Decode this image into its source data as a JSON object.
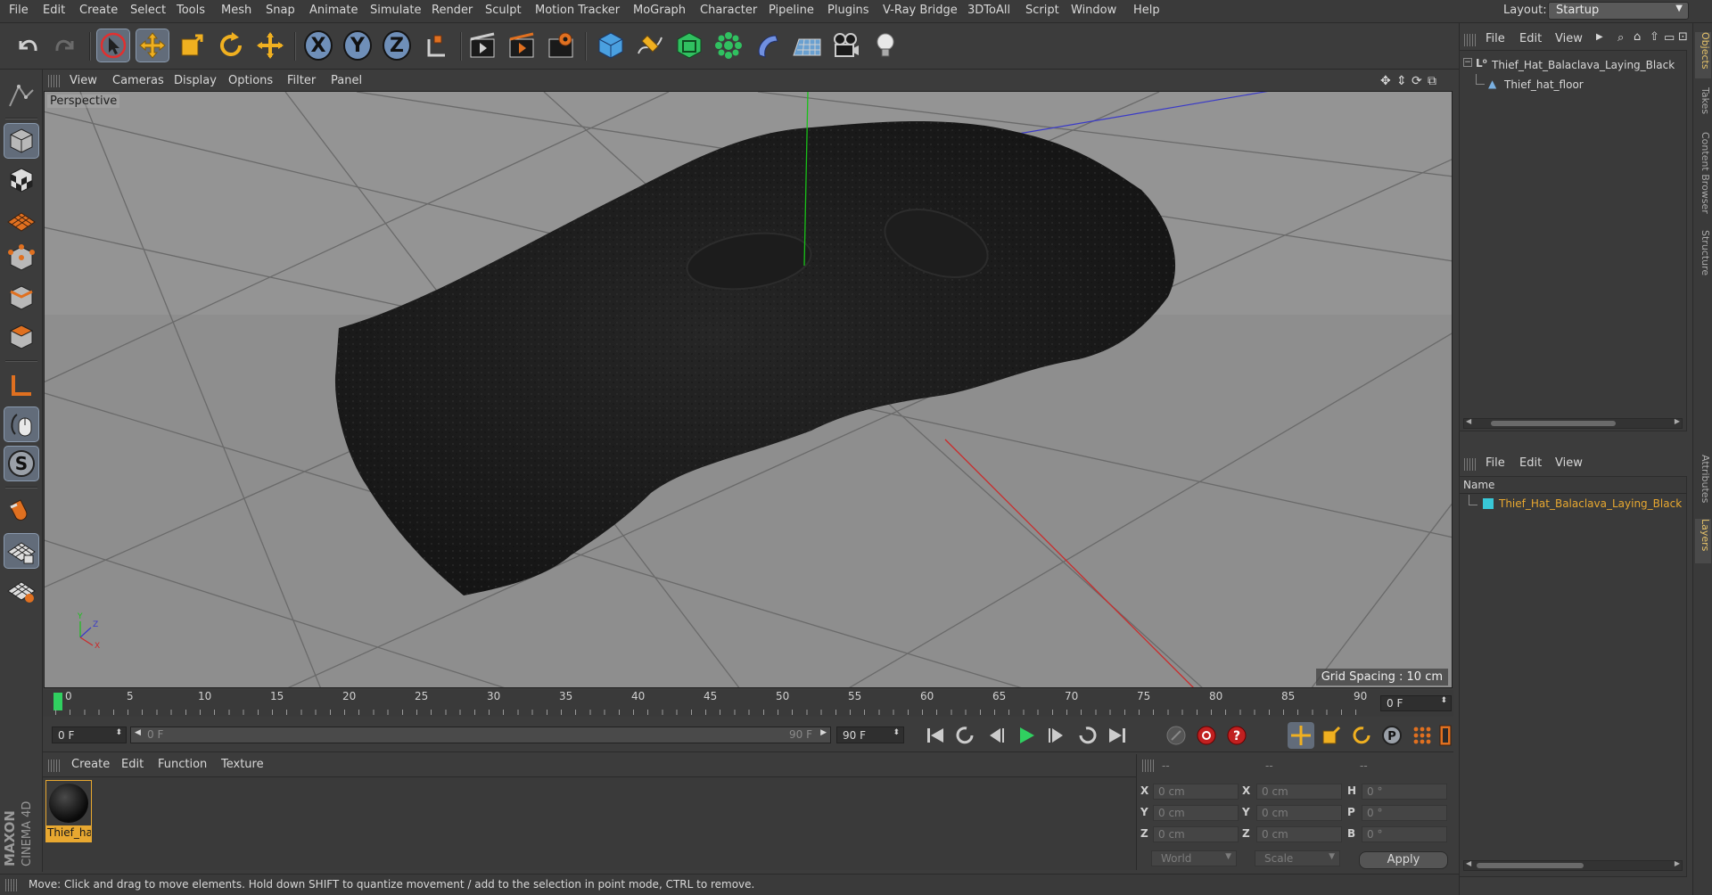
{
  "menubar": {
    "items": [
      "File",
      "Edit",
      "Create",
      "Select",
      "Tools",
      "Mesh",
      "Snap",
      "Animate",
      "Simulate",
      "Render",
      "Sculpt",
      "Motion Tracker",
      "MoGraph",
      "Character",
      "Pipeline",
      "Plugins",
      "V-Ray Bridge",
      "3DToAll",
      "Script",
      "Window",
      "Help"
    ],
    "layout_label": "Layout:",
    "layout_value": "Startup"
  },
  "viewport": {
    "menu": [
      "View",
      "Cameras",
      "Display",
      "Options",
      "Filter",
      "Panel"
    ],
    "camera_label": "Perspective",
    "grid_spacing": "Grid Spacing : 10 cm",
    "colors": {
      "background": "#8f8f8f",
      "object": "#1c1c1c",
      "y_axis": "#19c219",
      "x_axis": "#cc2a2a",
      "z_axis": "#3a3ac8"
    }
  },
  "timeline": {
    "ticks": [
      "0",
      "5",
      "10",
      "15",
      "20",
      "25",
      "30",
      "35",
      "40",
      "45",
      "50",
      "55",
      "60",
      "65",
      "70",
      "75",
      "80",
      "85",
      "90"
    ],
    "current_frame": "0 F"
  },
  "transport": {
    "start_field": "0 F",
    "slider_left": "0 F",
    "slider_right": "90 F",
    "end_field": "90 F"
  },
  "material_panel": {
    "menu": [
      "Create",
      "Edit",
      "Function",
      "Texture"
    ],
    "material_name": "Thief_ha"
  },
  "coordinates": {
    "headers": [
      "--",
      "--",
      "--"
    ],
    "rows": [
      {
        "l1": "X",
        "v1": "0 cm",
        "l2": "X",
        "v2": "0 cm",
        "l3": "H",
        "v3": "0 °"
      },
      {
        "l1": "Y",
        "v1": "0 cm",
        "l2": "Y",
        "v2": "0 cm",
        "l3": "P",
        "v3": "0 °"
      },
      {
        "l1": "Z",
        "v1": "0 cm",
        "l2": "Z",
        "v2": "0 cm",
        "l3": "B",
        "v3": "0 °"
      }
    ],
    "dropdown_world": "World",
    "dropdown_scale": "Scale",
    "apply": "Apply"
  },
  "status": {
    "text": "Move: Click and drag to move elements. Hold down SHIFT to quantize movement / add to the selection in point mode, CTRL to remove."
  },
  "objects_panel": {
    "menu": [
      "File",
      "Edit",
      "View"
    ],
    "items": [
      "Thief_Hat_Balaclava_Laying_Black",
      "Thief_hat_floor"
    ]
  },
  "layers_panel": {
    "menu": [
      "File",
      "Edit",
      "View"
    ],
    "column_name": "Name",
    "items": [
      "Thief_Hat_Balaclava_Laying_Black"
    ],
    "layer_color": "#38c8d8",
    "highlight_color": "#e8a830"
  },
  "side_tabs": [
    "Objects",
    "Takes",
    "Content Browser",
    "Structure",
    "Attributes",
    "Layers"
  ],
  "brand": {
    "line1": "MAXON",
    "line2": "CINEMA 4D"
  }
}
